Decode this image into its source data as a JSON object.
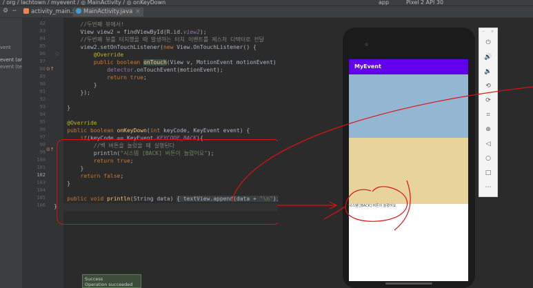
{
  "topbar": {
    "breadcrumb": "/ org / lachtown / myevent / ◎ MainActivity / ◎ onKeyDown",
    "run_config": "app",
    "device": "Pixel 2 API 30"
  },
  "tabs": [
    {
      "label": "activity_main.xml",
      "color": "#e8865a"
    },
    {
      "label": "MainActivity.java",
      "color": "#3f9ad8"
    }
  ],
  "left_panel": {
    "items": [
      "vent",
      "event (and",
      "event (test"
    ]
  },
  "editor": {
    "line_numbers": [
      "82",
      "83",
      "84",
      "85",
      "86",
      "87",
      "88",
      "89",
      "90",
      "91",
      "92",
      "93",
      "94",
      "95",
      "96",
      "97",
      "98",
      "99",
      "100",
      "101",
      "102",
      "103",
      "104",
      "105",
      "106"
    ],
    "current_line": "102"
  },
  "toast": {
    "title": "Success",
    "message": "Operation succeeded"
  },
  "emulator": {
    "app_title": "MyEvent",
    "textview_text": "시스템 [BACK] 버튼이 눌렸어요",
    "colors": {
      "appbar": "#6200ee",
      "view1": "#93b6d3",
      "view2": "#e8d49a"
    }
  },
  "emulator_controls": {
    "items": [
      {
        "icon": "power-icon",
        "glyph": "⏻"
      },
      {
        "icon": "volume-up-icon",
        "glyph": "🔊"
      },
      {
        "icon": "volume-down-icon",
        "glyph": "🔉"
      },
      {
        "icon": "rotate-left-icon",
        "glyph": "⟲"
      },
      {
        "icon": "rotate-right-icon",
        "glyph": "⟳"
      },
      {
        "icon": "camera-icon",
        "glyph": "⌗"
      },
      {
        "icon": "zoom-in-icon",
        "glyph": "⊕"
      },
      {
        "icon": "back-icon",
        "glyph": "◁"
      },
      {
        "icon": "home-icon",
        "glyph": "○"
      },
      {
        "icon": "overview-icon",
        "glyph": "□"
      },
      {
        "icon": "more-icon",
        "glyph": "⋯"
      }
    ]
  }
}
